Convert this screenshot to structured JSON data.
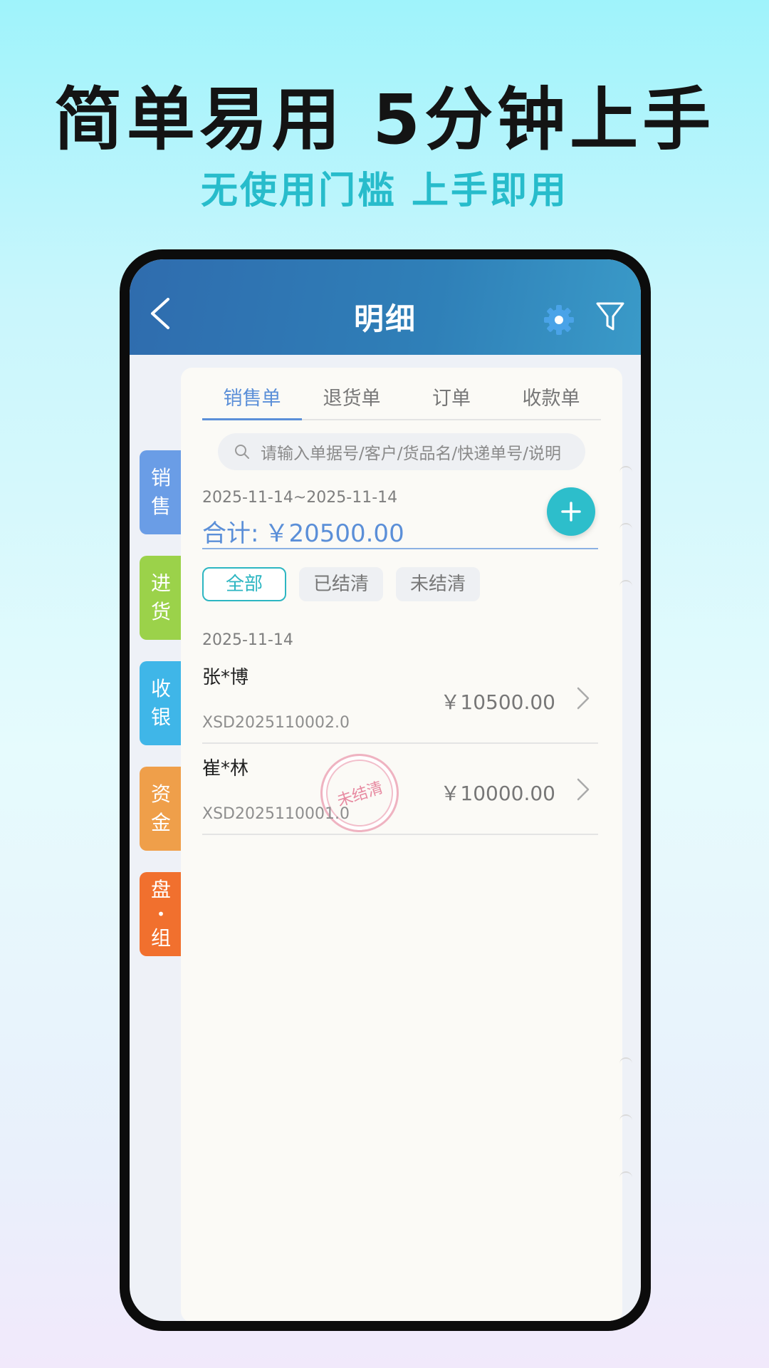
{
  "promo": {
    "headline": "简单易用 5分钟上手",
    "subline": "无使用门槛 上手即用"
  },
  "appbar": {
    "title": "明细",
    "icons": [
      "back-arrow-icon",
      "gear-icon",
      "filter-icon"
    ]
  },
  "sidebar": {
    "items": [
      {
        "label_top": "销",
        "label_bottom": "售",
        "color": "#6a9de6"
      },
      {
        "label_top": "进",
        "label_bottom": "货",
        "color": "#9bd24a"
      },
      {
        "label_top": "收",
        "label_bottom": "银",
        "color": "#3fb6e8"
      },
      {
        "label_top": "资",
        "label_bottom": "金",
        "color": "#ef9f4a"
      },
      {
        "label_top": "盘",
        "label_mid": "•",
        "label_bottom": "组",
        "color": "#f1702e"
      }
    ]
  },
  "tabs": [
    "销售单",
    "退货单",
    "订单",
    "收款单"
  ],
  "search": {
    "placeholder": "请输入单据号/客户/货品名/快递单号/说明"
  },
  "summary": {
    "date_range": "2025-11-14~2025-11-14",
    "total_label": "合计:",
    "total_value": "￥20500.00"
  },
  "filters": [
    "全部",
    "已结清",
    "未结清"
  ],
  "group_date": "2025-11-14",
  "records": [
    {
      "name": "张*博",
      "amount": "￥10500.00",
      "code": "XSD2025110002.0",
      "stamp": ""
    },
    {
      "name": "崔*林",
      "amount": "￥10000.00",
      "code": "XSD2025110001.0",
      "stamp": "未结清"
    }
  ],
  "colors": {
    "accent": "#5b8fd8",
    "teal": "#2dbecb",
    "appbar": "#2f6cae"
  }
}
